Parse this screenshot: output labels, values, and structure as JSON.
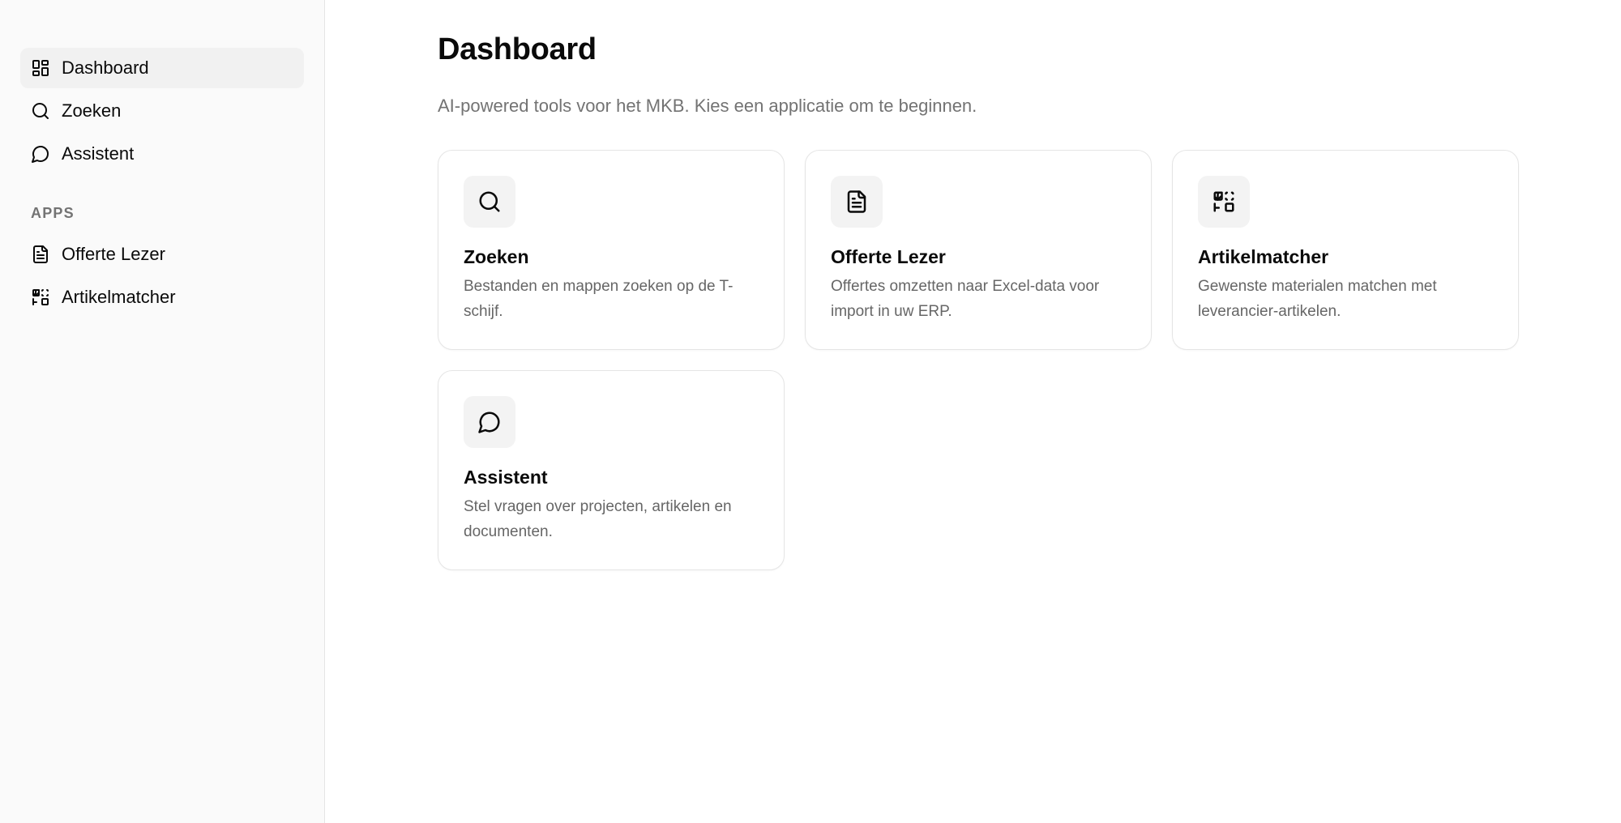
{
  "sidebar": {
    "nav": [
      {
        "label": "Dashboard",
        "icon": "dashboard-icon",
        "active": true
      },
      {
        "label": "Zoeken",
        "icon": "search-icon",
        "active": false
      },
      {
        "label": "Assistent",
        "icon": "chat-icon",
        "active": false
      }
    ],
    "section_label": "APPS",
    "apps": [
      {
        "label": "Offerte Lezer",
        "icon": "document-icon"
      },
      {
        "label": "Artikelmatcher",
        "icon": "match-icon"
      }
    ]
  },
  "main": {
    "title": "Dashboard",
    "subtitle": "AI-powered tools voor het MKB. Kies een applicatie om te beginnen.",
    "cards": [
      {
        "title": "Zoeken",
        "description": "Bestanden en mappen zoeken op de T-schijf.",
        "icon": "search-icon"
      },
      {
        "title": "Offerte Lezer",
        "description": "Offertes omzetten naar Excel-data voor import in uw ERP.",
        "icon": "document-icon"
      },
      {
        "title": "Artikelmatcher",
        "description": "Gewenste materialen matchen met leverancier-artikelen.",
        "icon": "match-icon"
      },
      {
        "title": "Assistent",
        "description": "Stel vragen over projecten, artikelen en documenten.",
        "icon": "chat-icon"
      }
    ]
  },
  "colors": {
    "sidebar_bg": "#fafafa",
    "active_item_bg": "#f1f1f1",
    "muted_text": "#737373",
    "border": "#e5e5e5",
    "icon_box_bg": "#f3f3f3"
  }
}
